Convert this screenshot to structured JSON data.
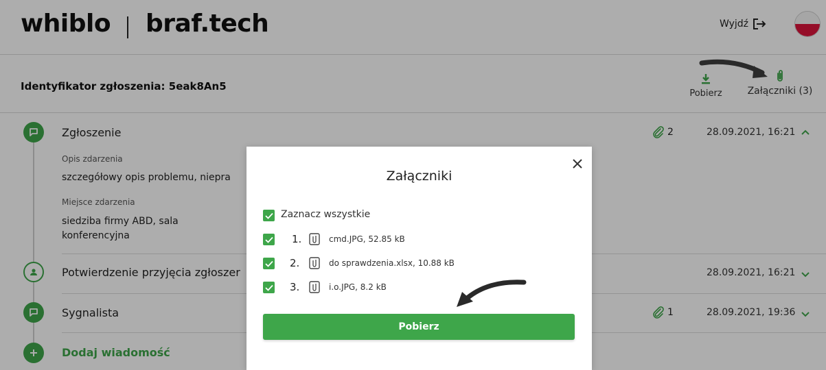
{
  "header": {
    "brand_primary": "whiblo",
    "brand_secondary": "braf.tech",
    "logout_label": "Wyjdź",
    "flag_colors": {
      "top": "#f5f5f5",
      "bottom": "#dc143c"
    }
  },
  "ticket": {
    "id_label": "Identyfikator zgłoszenia: 5eak8An5",
    "download_label": "Pobierz",
    "attachments_label": "Załączniki (3)"
  },
  "timeline": {
    "rows": [
      {
        "title": "Zgłoszenie",
        "attachments": "2",
        "date": "28.09.2021, 16:21",
        "expanded": true,
        "fields": [
          {
            "label": "Opis zdarzenia",
            "value": "szczegółowy opis  problemu, niepra"
          },
          {
            "label": "Miejsce zdarzenia",
            "value_lines": [
              "siedziba firmy ABD, sala",
              "konferencyjna"
            ]
          }
        ]
      },
      {
        "title": "Potwierdzenie przyjęcia zgłoszer",
        "date": "28.09.2021, 16:21",
        "expanded": false
      },
      {
        "title": "Sygnalista",
        "attachments": "1",
        "date": "28.09.2021, 19:36",
        "expanded": false
      }
    ],
    "add_message_label": "Dodaj wiadomość"
  },
  "modal": {
    "title": "Załączniki",
    "select_all_label": "Zaznacz wszystkie",
    "files": [
      {
        "number": "1.",
        "name": "cmd.JPG, 52.85 kB",
        "checked": true
      },
      {
        "number": "2.",
        "name": "do sprawdzenia.xlsx, 10.88 kB",
        "checked": true
      },
      {
        "number": "3.",
        "name": "i.o.JPG, 8.2 kB",
        "checked": true
      }
    ],
    "download_button_label": "Pobierz"
  },
  "colors": {
    "accent": "#3ea64a",
    "overlay": "rgba(0,0,0,0.32)"
  }
}
